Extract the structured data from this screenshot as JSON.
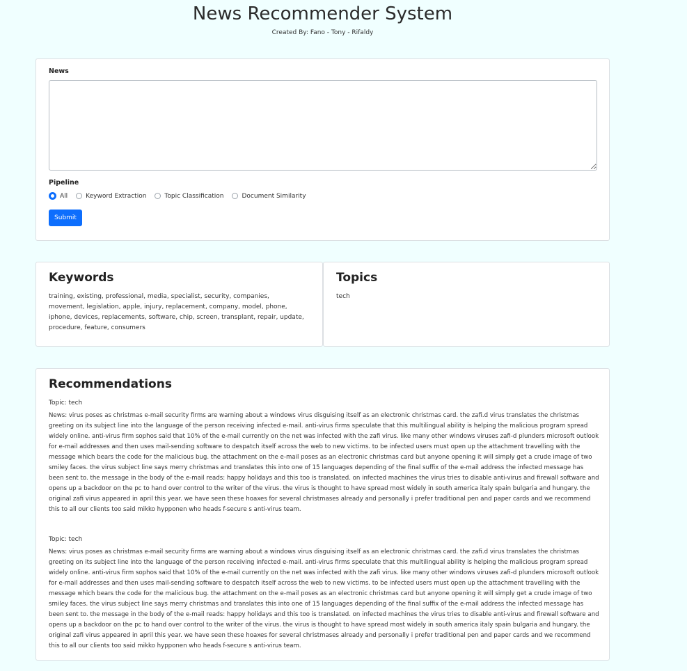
{
  "header": {
    "title": "News Recommender System",
    "subtitle": "Created By: Fano - Tony - Rifaldy"
  },
  "form": {
    "news_label": "News",
    "news_value": "",
    "pipeline_label": "Pipeline",
    "options": [
      {
        "label": "All",
        "checked": true
      },
      {
        "label": "Keyword Extraction",
        "checked": false
      },
      {
        "label": "Topic Classification",
        "checked": false
      },
      {
        "label": "Document Similarity",
        "checked": false
      }
    ],
    "submit_label": "Submit"
  },
  "keywords": {
    "title": "Keywords",
    "text": "training, existing, professional, media, specialist, security, companies, movement, legislation, apple, injury, replacement, company, model, phone, iphone, devices, replacements, software, chip, screen, transplant, repair, update, procedure, feature, consumers"
  },
  "topics": {
    "title": "Topics",
    "text": "tech"
  },
  "recommendations": {
    "title": "Recommendations",
    "items": [
      {
        "topic": "Topic: tech",
        "news": "News: virus poses as christmas e-mail security firms are warning about a windows virus disguising itself as an electronic christmas card. the zafi.d virus translates the christmas greeting on its subject line into the language of the person receiving infected e-mail. anti-virus firms speculate that this multilingual ability is helping the malicious program spread widely online. anti-virus firm sophos said that 10% of the e-mail currently on the net was infected with the zafi virus. like many other windows viruses zafi-d plunders microsoft outlook for e-mail addresses and then uses mail-sending software to despatch itself across the web to new victims. to be infected users must open up the attachment travelling with the message which bears the code for the malicious bug. the attachment on the e-mail poses as an electronic christmas card but anyone opening it will simply get a crude image of two smiley faces. the virus subject line says merry christmas and translates this into one of 15 languages depending of the final suffix of the e-mail address the infected message has been sent to. the message in the body of the e-mail reads: happy holidays and this too is translated. on infected machines the virus tries to disable anti-virus and firewall software and opens up a backdoor on the pc to hand over control to the writer of the virus. the virus is thought to have spread most widely in south america italy spain bulgaria and hungary. the original zafi virus appeared in april this year. we have seen these hoaxes for several christmases already and personally i prefer traditional pen and paper cards and we recommend this to all our clients too said mikko hypponen who heads f-secure s anti-virus team."
      },
      {
        "topic": "Topic: tech",
        "news": "News: virus poses as christmas e-mail security firms are warning about a windows virus disguising itself as an electronic christmas card. the zafi.d virus translates the christmas greeting on its subject line into the language of the person receiving infected e-mail. anti-virus firms speculate that this multilingual ability is helping the malicious program spread widely online. anti-virus firm sophos said that 10% of the e-mail currently on the net was infected with the zafi virus. like many other windows viruses zafi-d plunders microsoft outlook for e-mail addresses and then uses mail-sending software to despatch itself across the web to new victims. to be infected users must open up the attachment travelling with the message which bears the code for the malicious bug. the attachment on the e-mail poses as an electronic christmas card but anyone opening it will simply get a crude image of two smiley faces. the virus subject line says merry christmas and translates this into one of 15 languages depending of the final suffix of the e-mail address the infected message has been sent to. the message in the body of the e-mail reads: happy holidays and this too is translated. on infected machines the virus tries to disable anti-virus and firewall software and opens up a backdoor on the pc to hand over control to the writer of the virus. the virus is thought to have spread most widely in south america italy spain bulgaria and hungary. the original zafi virus appeared in april this year. we have seen these hoaxes for several christmases already and personally i prefer traditional pen and paper cards and we recommend this to all our clients too said mikko hypponen who heads f-secure s anti-virus team."
      }
    ]
  },
  "colors": {
    "background": "#f0ffff",
    "accent": "#0d6efd"
  }
}
